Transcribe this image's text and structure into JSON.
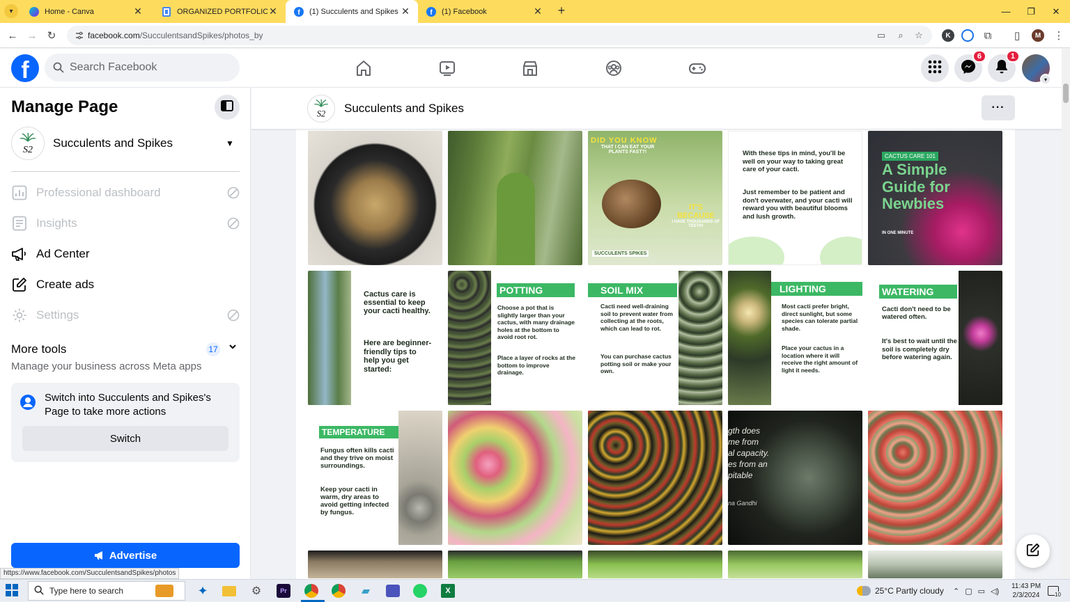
{
  "browser": {
    "tabs": [
      {
        "title": "Home - Canva",
        "active": false
      },
      {
        "title": "ORGANIZED PORTFOLIO - Web",
        "active": false
      },
      {
        "title": "(1) Succulents and Spikes | Face",
        "active": true
      },
      {
        "title": "(1) Facebook",
        "active": false
      }
    ],
    "url_host": "facebook.com",
    "url_path": "/SucculentsandSpikes/photos_by",
    "status_url": "https://www.facebook.com/SucculentsandSpikes/photos",
    "profile_initial": "M",
    "ext_k": "K"
  },
  "fb": {
    "search_placeholder": "Search Facebook",
    "messenger_badge": "6",
    "notifications_badge": "1",
    "nav_icons": [
      "home-icon",
      "watch-icon",
      "marketplace-icon",
      "groups-icon",
      "gaming-icon"
    ]
  },
  "sidebar": {
    "title": "Manage Page",
    "page_name": "Succulents and Spikes",
    "items": [
      {
        "label": "Professional dashboard",
        "icon": "dashboard-icon",
        "disabled": true
      },
      {
        "label": "Insights",
        "icon": "insights-icon",
        "disabled": true
      },
      {
        "label": "Ad Center",
        "icon": "megaphone-icon",
        "disabled": false
      },
      {
        "label": "Create ads",
        "icon": "pencil-square-icon",
        "disabled": false
      },
      {
        "label": "Settings",
        "icon": "gear-icon",
        "disabled": true
      }
    ],
    "more_tools_title": "More tools",
    "more_tools_count": "17",
    "more_tools_sub": "Manage your business across Meta apps",
    "switch_text": "Switch into Succulents and Spikes's Page to take more actions",
    "switch_button": "Switch",
    "advertise_button": "Advertise"
  },
  "page_header": {
    "name": "Succulents and Spikes",
    "more_label": "···"
  },
  "photos": [
    {
      "name": "photo-cactus-pot",
      "texts": []
    },
    {
      "name": "photo-green-cactus",
      "texts": []
    },
    {
      "name": "photo-did-you-know",
      "texts": [
        "DID YOU KNOW",
        "THAT I CAN EAT YOUR PLANTS FAST?!",
        "IT'S BECAUSE",
        "I HAVE THOUSANDS OF TEETH!",
        "SUCCULENTS SPIKES"
      ]
    },
    {
      "name": "photo-tips-in-mind",
      "texts": [
        "With these tips in mind, you'll be well on your way to taking great care of your cacti.",
        "Just remember to be patient and don't overwater, and your cacti will reward you with beautiful blooms and lush growth."
      ]
    },
    {
      "name": "photo-simple-guide",
      "texts": [
        "CACTUS CARE 101",
        "A Simple Guide for Newbies",
        "IN ONE MINUTE"
      ]
    },
    {
      "name": "photo-cactus-care-essential",
      "texts": [
        "Cactus care is essential to keep your cacti healthy.",
        "Here are beginner-friendly tips to help you get started:"
      ]
    },
    {
      "name": "photo-potting",
      "texts": [
        "POTTING",
        "Choose a pot that is slightly larger than your cactus, with many drainage holes at the bottom to avoid root rot.",
        "Place a layer of rocks at the bottom to improve drainage."
      ]
    },
    {
      "name": "photo-soil-mix",
      "texts": [
        "SOIL MIX",
        "Cacti need well-draining soil to prevent water from collecting at the roots, which can lead to rot.",
        "You can purchase cactus potting soil or make your own."
      ]
    },
    {
      "name": "photo-lighting",
      "texts": [
        "LIGHTING",
        "Most cacti prefer bright, direct sunlight, but some species can tolerate partial shade.",
        "Place your cactus in a location where it will receive the right amount of light it needs."
      ]
    },
    {
      "name": "photo-watering",
      "texts": [
        "WATERING",
        "Cacti don't need to be watered often.",
        "It's best to wait until the soil is completely dry before watering again."
      ]
    },
    {
      "name": "photo-temperature",
      "texts": [
        "TEMPERATURE",
        "Fungus often kills cacti and they trive on moist surroundings.",
        "Keep your cacti in warm, dry areas to avoid getting infected by fungus."
      ]
    },
    {
      "name": "photo-colorful-succulents",
      "texts": []
    },
    {
      "name": "photo-grafted-cacti",
      "texts": []
    },
    {
      "name": "photo-haworthia-quote",
      "texts": [
        "gth does",
        "me from",
        "al capacity.",
        "es from an",
        "pitable",
        "na Gandhi"
      ]
    },
    {
      "name": "photo-red-cacti",
      "texts": []
    },
    {
      "name": "photo-row4-1",
      "texts": []
    },
    {
      "name": "photo-row4-2",
      "texts": []
    },
    {
      "name": "photo-row4-3",
      "texts": []
    },
    {
      "name": "photo-row4-4",
      "texts": []
    },
    {
      "name": "photo-row4-5",
      "texts": []
    }
  ],
  "taskbar": {
    "search_placeholder": "Type here to search",
    "weather": "25°C  Partly cloudy",
    "time": "11:43 PM",
    "date": "2/3/2024",
    "notif_count": "10"
  },
  "colors": {
    "fb_blue": "#0866ff",
    "chrome_tabstrip": "#fddb5d",
    "tip_green": "#3cb864"
  }
}
